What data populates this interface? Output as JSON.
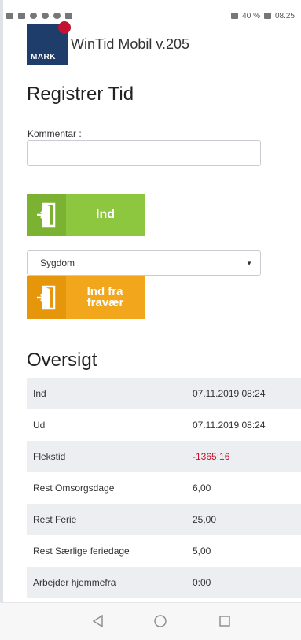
{
  "status_bar": {
    "left_icons": [
      "message-icon",
      "signal-icon",
      "wifi-icon",
      "sync-icon",
      "whatsapp-icon",
      "document-icon"
    ],
    "right_text": "40 %",
    "time": "08.25"
  },
  "header": {
    "logo_text": "MARK",
    "app_title": "WinTid Mobil v.205"
  },
  "register": {
    "title": "Registrer Tid",
    "comment_label": "Kommentar :",
    "comment_value": "",
    "ind_button_label": "Ind",
    "absence_select_value": "Sygdom",
    "absence_button_label": "Ind fra\nfravær"
  },
  "overview": {
    "title": "Oversigt",
    "rows": [
      {
        "label": "Ind",
        "value": "07.11.2019 08:24"
      },
      {
        "label": "Ud",
        "value": "07.11.2019 08:24"
      },
      {
        "label": "Flekstid",
        "value": "-1365:16"
      },
      {
        "label": "Rest Omsorgsdage",
        "value": "6,00"
      },
      {
        "label": "Rest Ferie",
        "value": "25,00"
      },
      {
        "label": "Rest Særlige feriedage",
        "value": "5,00"
      },
      {
        "label": "Arbejder hjemmefra",
        "value": "0:00"
      }
    ]
  },
  "colors": {
    "ind_button": "#8dc63f",
    "absence_button": "#f2a61c",
    "negative_value": "#c8102e",
    "logo_bg": "#1f3d6b"
  }
}
